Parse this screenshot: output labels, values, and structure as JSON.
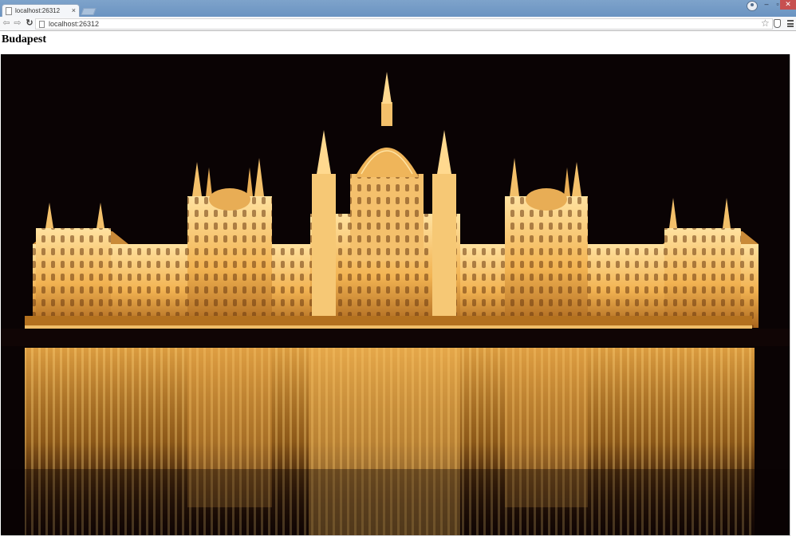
{
  "browser": {
    "tab_title": "localhost:26312",
    "tab_close": "×",
    "url": "localhost:26312",
    "icons": [
      "page-icon",
      "back-icon",
      "forward-icon",
      "reload-icon",
      "star-icon",
      "extension-icon",
      "menu-icon",
      "user-icon"
    ]
  },
  "page": {
    "title": "Budapest",
    "image_subject": "Hungarian Parliament Building illuminated at night with reflection on river"
  },
  "colors": {
    "titlebar": "#6a93c1",
    "night_sky": "#0a0304",
    "building_glow": "#f0b860",
    "reflection": "#c98a2c"
  }
}
